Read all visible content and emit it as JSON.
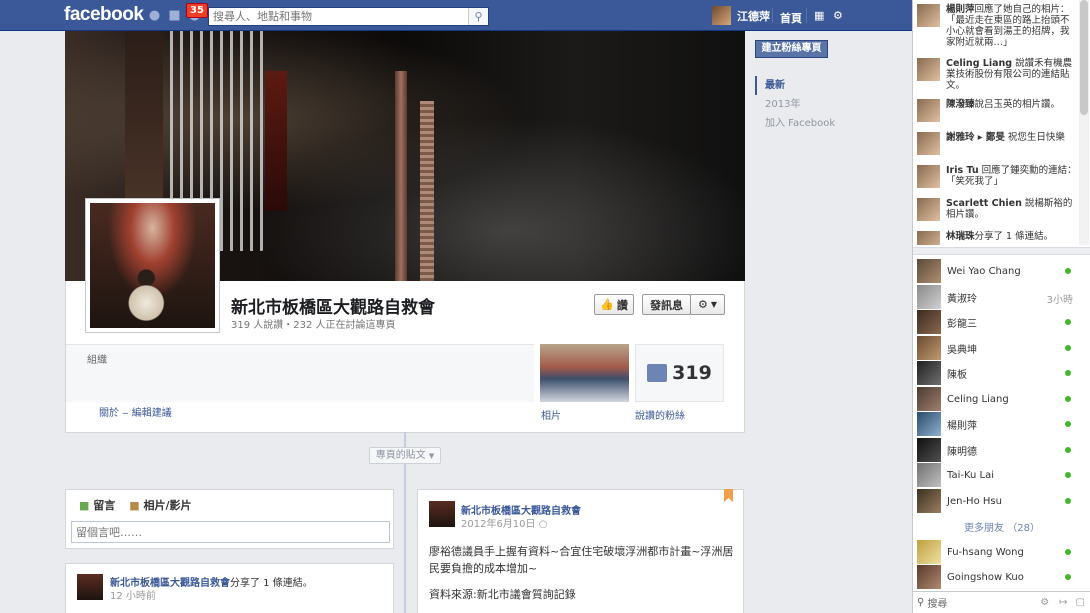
{
  "topbar": {
    "logo": "facebook",
    "notif_count": "35",
    "search_placeholder": "搜尋人、地點和事物",
    "user_name": "江德萍",
    "home_label": "首頁"
  },
  "page": {
    "title": "新北市板橋區大觀路自救會",
    "subtitle": "319 人說讚・232 人正在討論這專頁",
    "like_btn": "讚",
    "message_btn": "發訊息",
    "category": "組織",
    "links": "關於 ‒ 編輯建議",
    "photos_label": "相片",
    "likes_count": "319",
    "likes_label": "說讚的粉絲",
    "posts_filter": "專頁的貼文"
  },
  "composer": {
    "tab_status": "留言",
    "tab_photo": "相片/影片",
    "placeholder": "留個言吧……"
  },
  "story_left": {
    "name": "新北市板橋區大觀路自救會",
    "action": "分享了 1 條連結。",
    "time": "12 小時前"
  },
  "story_right": {
    "name": "新北市板橋區大觀路自救會",
    "date": "2012年6月10日",
    "text1": "廖裕德議員手上握有資料~合宜住宅破壞浮洲都市計畫~浮洲居民要負擔的成本增加~",
    "text2": "資料來源:新北市議會質詢記錄"
  },
  "right_col": {
    "create_btn": "建立粉絲專頁",
    "years": [
      "最新",
      "2013年",
      "加入 Facebook"
    ]
  },
  "ticker": [
    {
      "name": "楊則萍",
      "text": "回應了她自己的相片：「最近走在東區的路上抬頭不小心就會看到湯王的招牌，我家附近就兩…」"
    },
    {
      "name": "Celing Liang",
      "text": "說讚禾有機農業技術股份有限公司的連結貼文。"
    },
    {
      "name": "陳潑臻",
      "text": "說吕玉英的相片讚。"
    },
    {
      "name": "謝雅玲 ▸ 鄭旻",
      "text": "祝您生日快樂"
    },
    {
      "name": "Iris Tu",
      "text": "回應了鍾奕勳的連結：「笑死我了」"
    },
    {
      "name": "Scarlett Chien",
      "text": "說楊斯裕的相片讚。"
    },
    {
      "name": "林瑞珠",
      "text": "分享了 1 條連結。"
    }
  ],
  "chat": [
    {
      "name": "Wei Yao Chang",
      "status": "online"
    },
    {
      "name": "黃淑玲",
      "status": "3小時"
    },
    {
      "name": "彭龍三",
      "status": "online"
    },
    {
      "name": "吳典坤",
      "status": "online"
    },
    {
      "name": "陳板",
      "status": "online"
    },
    {
      "name": "Celing Liang",
      "status": "online"
    },
    {
      "name": "楊則萍",
      "status": "online"
    },
    {
      "name": "陳明德",
      "status": "online"
    },
    {
      "name": "Tai-Ku Lai",
      "status": "online"
    },
    {
      "name": "Jen-Ho Hsu",
      "status": "online"
    }
  ],
  "more_friends": "更多朋友 （28）",
  "chat_more": [
    {
      "name": "Fu-hsang Wong",
      "status": "online"
    },
    {
      "name": "Goingshow Kuo",
      "status": "online"
    }
  ],
  "chat_search": "搜尋",
  "colors": {
    "brand": "#3b5998",
    "online": "#42b72a",
    "badge": "#f03d25"
  }
}
